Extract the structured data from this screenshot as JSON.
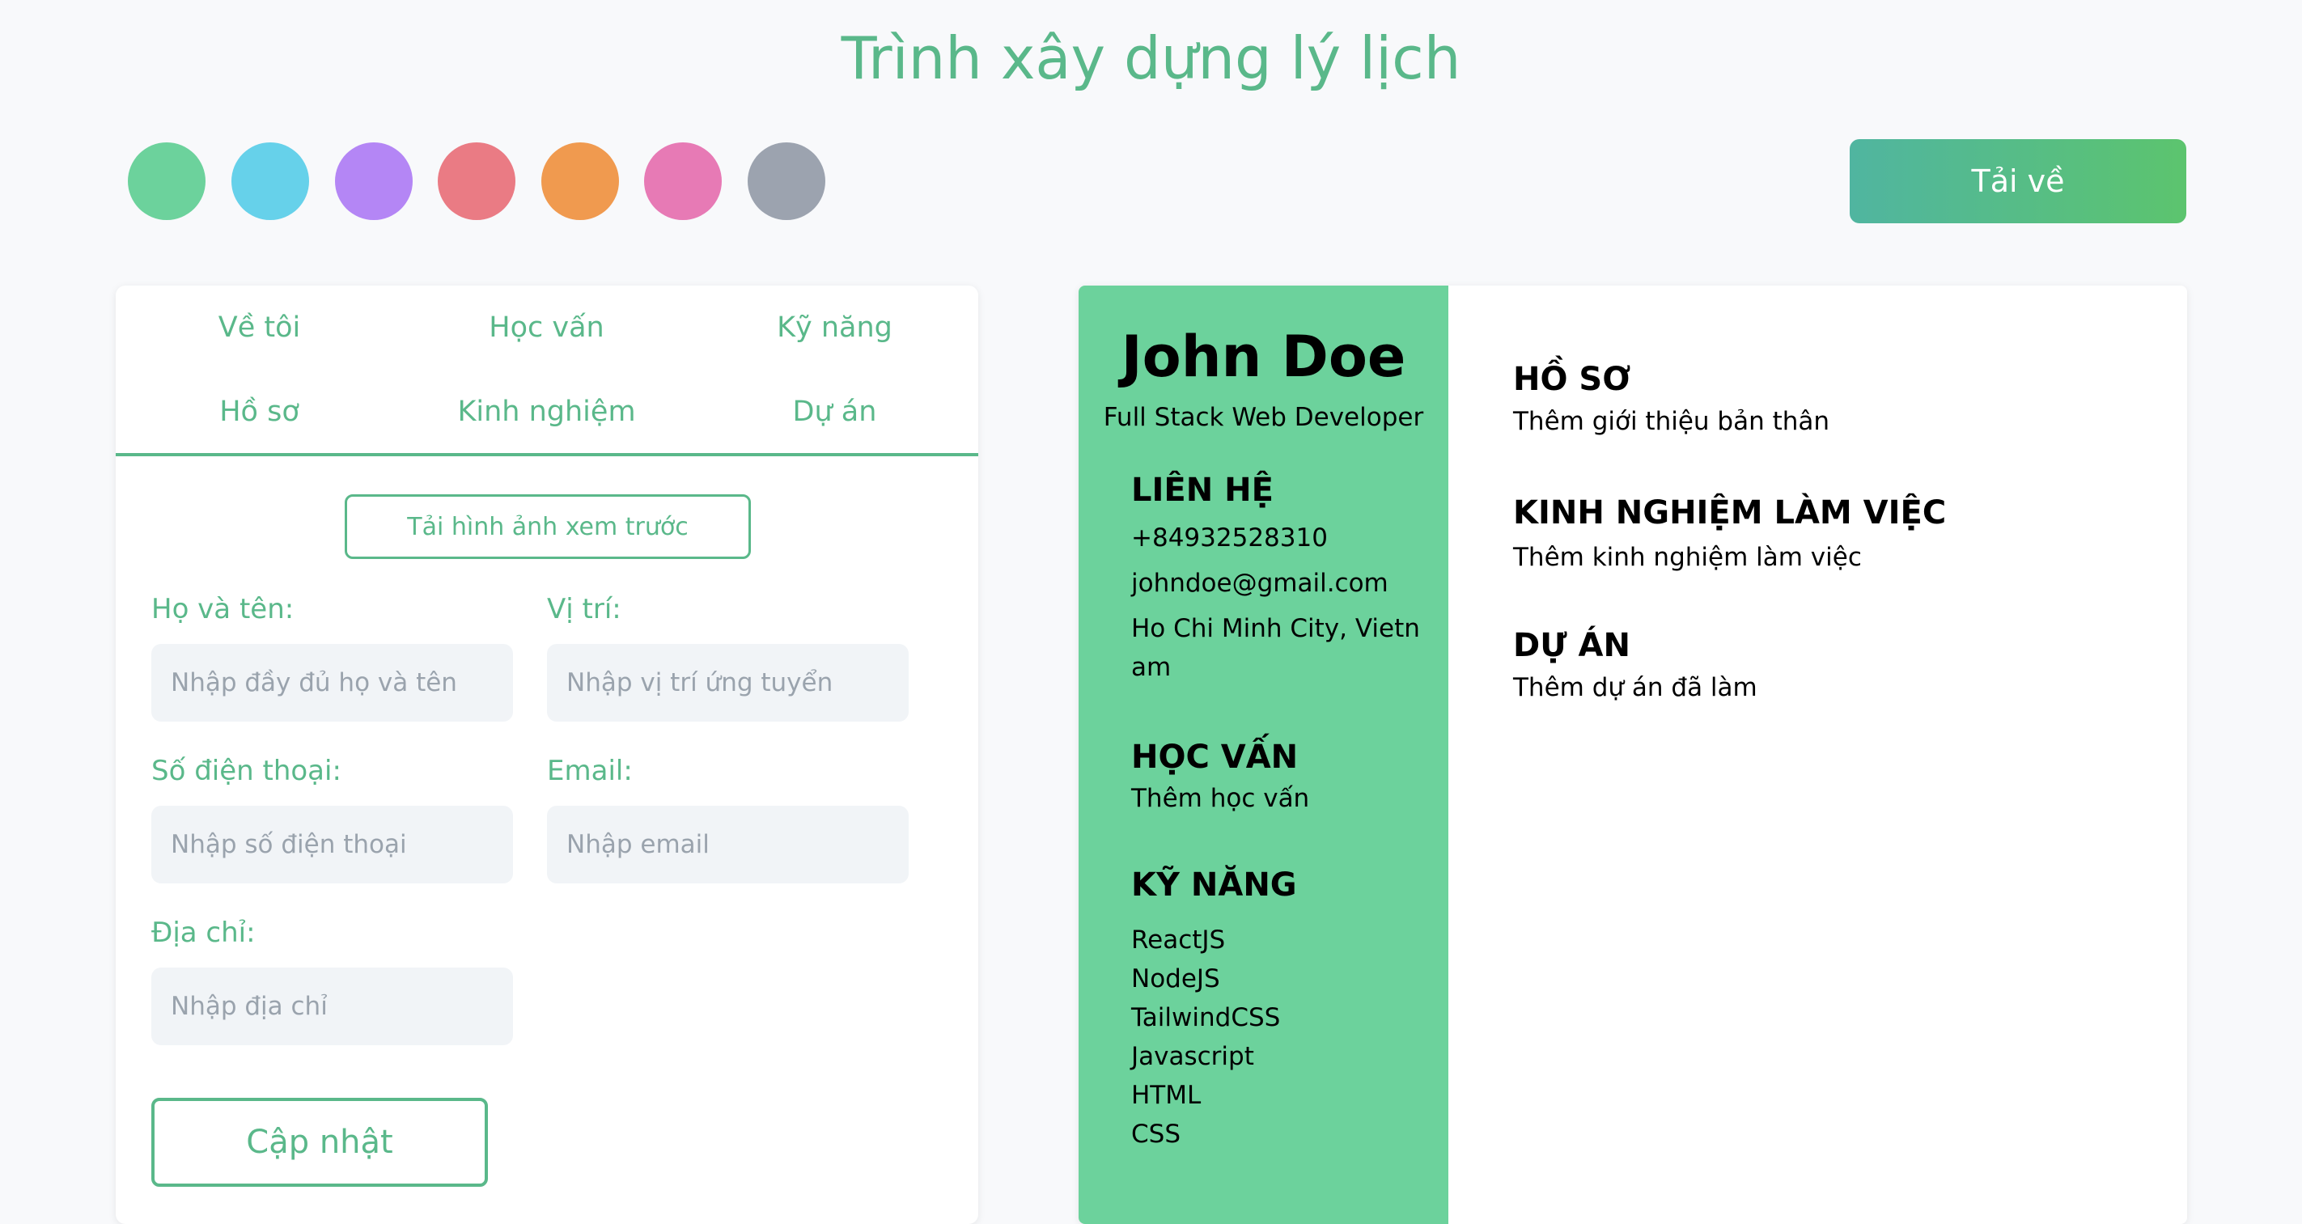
{
  "app": {
    "title": "Trình xây dựng lý lịch"
  },
  "themes": [
    {
      "name": "green-swatch",
      "color": "#6cd29c"
    },
    {
      "name": "cyan-swatch",
      "color": "#66d1ea"
    },
    {
      "name": "purple-swatch",
      "color": "#b486f5"
    },
    {
      "name": "red-swatch",
      "color": "#ea7b84"
    },
    {
      "name": "orange-swatch",
      "color": "#f09a4f"
    },
    {
      "name": "pink-swatch",
      "color": "#e77ab5"
    },
    {
      "name": "gray-swatch",
      "color": "#9ca3af"
    }
  ],
  "toolbar": {
    "download_label": "Tải về"
  },
  "editor": {
    "tabs": [
      "Về tôi",
      "Học vấn",
      "Kỹ năng",
      "Hồ sơ",
      "Kinh nghiệm",
      "Dự án"
    ],
    "upload_label": "Tải hình ảnh xem trước",
    "fields": {
      "name": {
        "label": "Họ và tên:",
        "placeholder": "Nhập đầy đủ họ và tên"
      },
      "position": {
        "label": "Vị trí:",
        "placeholder": "Nhập vị trí ứng tuyển"
      },
      "phone": {
        "label": "Số điện thoại:",
        "placeholder": "Nhập số điện thoại"
      },
      "email": {
        "label": "Email:",
        "placeholder": "Nhập email"
      },
      "address": {
        "label": "Địa chỉ:",
        "placeholder": "Nhập địa chỉ"
      }
    },
    "update_label": "Cập nhật"
  },
  "resume": {
    "name": "John Doe",
    "role": "Full Stack Web Developer",
    "contact_heading": "LIÊN HỆ",
    "phone": "+84932528310",
    "email": "johndoe@gmail.com",
    "address": "Ho Chi Minh City, Vietnam",
    "education_heading": "HỌC VẤN",
    "education_text": "Thêm học vấn",
    "skills_heading": "KỸ NĂNG",
    "skills": [
      "ReactJS",
      "NodeJS",
      "TailwindCSS",
      "Javascript",
      "HTML",
      "CSS"
    ],
    "profile_heading": "HỒ SƠ",
    "profile_text": "Thêm giới thiệu bản thân",
    "experience_heading": "KINH NGHIỆM LÀM VIỆC",
    "experience_text": "Thêm kinh nghiệm làm việc",
    "projects_heading": "DỰ ÁN",
    "projects_text": "Thêm dự án đã làm"
  }
}
